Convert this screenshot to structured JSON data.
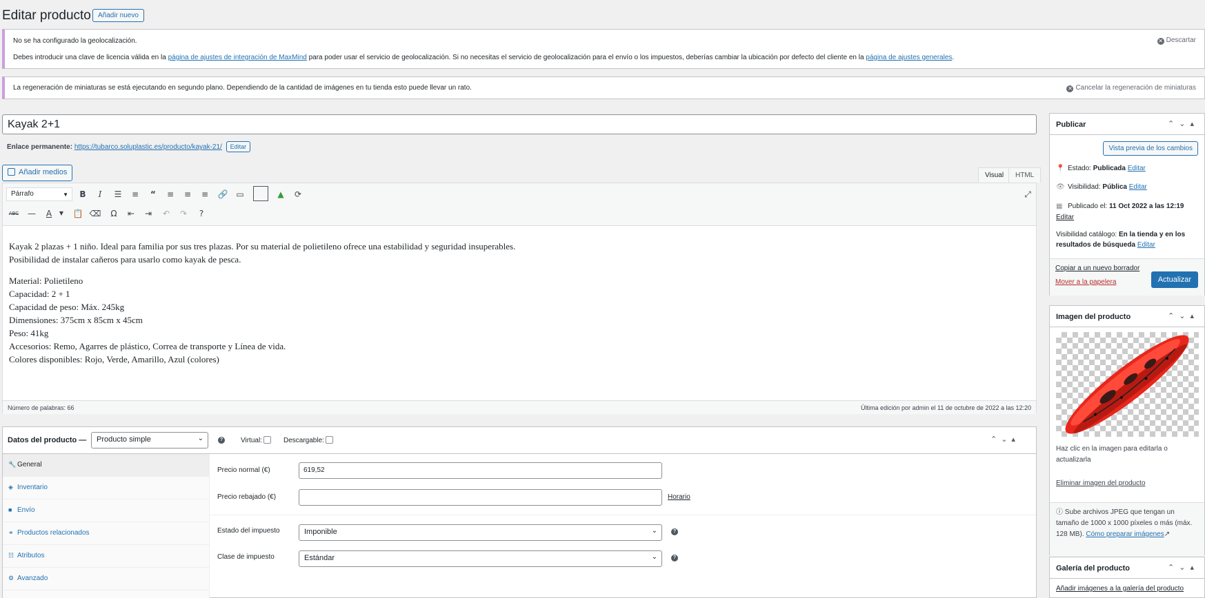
{
  "header": {
    "title": "Editar producto",
    "add_new": "Añadir nuevo"
  },
  "notices": {
    "geo": {
      "heading": "No se ha configurado la geolocalización.",
      "text_before": "Debes introducir una clave de licencia válida en la ",
      "link1": "página de ajustes de integración de MaxMind",
      "text_middle": " para poder usar el servicio de geolocalización. Si no necesitas el servicio de geolocalización para el envío o los impuestos, deberías cambiar la ubicación por defecto del cliente en la ",
      "link2": "página de ajustes generales",
      "text_after": ".",
      "dismiss": "Descartar"
    },
    "thumbs": {
      "text": "La regeneración de miniaturas se está ejecutando en segundo plano. Dependiendo de la cantidad de imágenes en tu tienda esto puede llevar un rato.",
      "cancel": "Cancelar la regeneración de miniaturas"
    }
  },
  "post": {
    "title": "Kayak 2+1",
    "permalink_label": "Enlace permanente:",
    "permalink_url": "https://tubarco.soluplastic.es/producto/kayak-21/",
    "permalink_edit": "Editar"
  },
  "editor": {
    "add_media": "Añadir medios",
    "tabs": [
      "Visual",
      "HTML"
    ],
    "format_select": "Párrafo",
    "paragraphs": [
      [
        "Kayak 2 plazas + 1 niño. Ideal para familia por sus tres plazas. Por su material de polietileno ofrece una estabilidad y seguridad insuperables.",
        "Posibilidad de instalar cañeros para usarlo como kayak de pesca."
      ],
      [
        "Material: Polietileno",
        "Capacidad: 2 + 1",
        "Capacidad de peso: Máx. 245kg",
        "Dimensiones: 375cm x 85cm x 45cm",
        "Peso: 41kg",
        "Accesorios: Remo, Agarres de plástico, Correa de transporte y Línea de vida.",
        "Colores disponibles: Rojo, Verde, Amarillo, Azul (colores)"
      ]
    ],
    "word_count": "Número de palabras: 66",
    "last_edit": "Última edición por admin el 11 de octubre de 2022 a las 12:20",
    "toolbar_icons": [
      "bold-icon",
      "italic-icon",
      "bullet-list-icon",
      "numbered-list-icon",
      "blockquote-icon",
      "align-left-icon",
      "align-center-icon",
      "align-right-icon",
      "link-icon",
      "read-more-icon",
      "toolbar-toggle-icon",
      "strikethrough-icon",
      "horizontal-line-icon",
      "text-color-icon",
      "paste-text-icon",
      "clear-formatting-icon",
      "special-char-icon",
      "outdent-icon",
      "indent-icon",
      "undo-icon",
      "redo-icon",
      "help-icon",
      "fullscreen-icon"
    ]
  },
  "product_data": {
    "title": "Datos del producto —",
    "type": "Producto simple",
    "virtual": "Virtual:",
    "downloadable": "Descargable:",
    "tabs": [
      "General",
      "Inventario",
      "Envío",
      "Productos relacionados",
      "Atributos",
      "Avanzado"
    ],
    "fields": {
      "regular_price_label": "Precio normal (€)",
      "regular_price": "619,52",
      "sale_price_label": "Precio rebajado (€)",
      "sale_price": "",
      "schedule": "Horario",
      "tax_status_label": "Estado del impuesto",
      "tax_status": "Imponible",
      "tax_class_label": "Clase de impuesto",
      "tax_class": "Estándar"
    }
  },
  "publish": {
    "title": "Publicar",
    "preview": "Vista previa de los cambios",
    "status": "Estado: ",
    "status_value": "Publicada",
    "visibility": "Visibilidad: ",
    "visibility_value": "Pública",
    "published": "Publicado el: ",
    "published_value": "11 Oct 2022 a las 12:19",
    "edit": "Editar",
    "catalog_line1": "Visibilidad catálogo: ",
    "catalog_value1": "En la tienda y en los",
    "catalog_value2": "resultados de búsqueda",
    "copy_draft": "Copiar a un nuevo borrador",
    "trash": "Mover a la papelera",
    "update": "Actualizar"
  },
  "product_image": {
    "title": "Imagen del producto",
    "hint1": "Haz clic en la imagen para editarla o",
    "hint2": "actualizarla",
    "remove": "Eliminar imagen del producto",
    "tip1": "Sube archivos JPEG que tengan un",
    "tip2": "tamaño de 1000 x 1000 píxeles o más (máx.",
    "tip3": "128 MB). ",
    "tip_link": "Cómo preparar imágenes"
  },
  "gallery": {
    "title": "Galería del producto",
    "add": "Añadir imágenes a la galería del producto"
  },
  "colors": {
    "accent": "#2271b1",
    "notice_border": "#c9a0dc",
    "kayak": "#e8261c"
  }
}
